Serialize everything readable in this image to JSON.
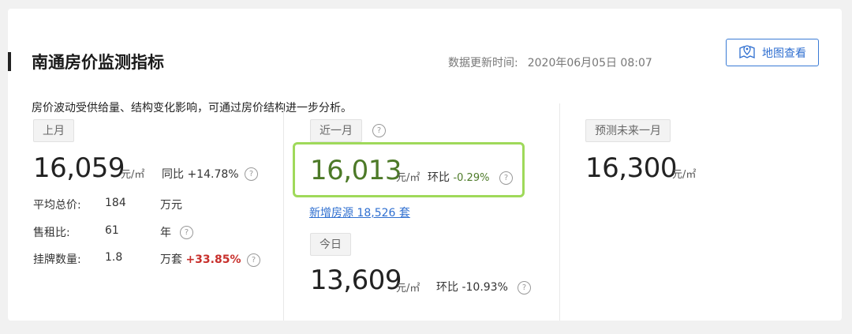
{
  "header": {
    "title": "南通房价监测指标",
    "update_label": "数据更新时间:",
    "update_time": "2020年06月05日 08:07",
    "map_button": "地图查看"
  },
  "description": "房价波动受供给量、结构变化影响，可通过房价结构进一步分析。",
  "last_month": {
    "tag": "上月",
    "price": "16,059",
    "unit": "元/㎡",
    "yoy_label": "同比",
    "yoy_value": "+14.78%",
    "rows": [
      {
        "label": "平均总价:",
        "value": "184",
        "unit": "万元"
      },
      {
        "label": "售租比:",
        "value": "61",
        "unit": "年"
      },
      {
        "label": "挂牌数量:",
        "value": "1.8",
        "unit": "万套",
        "change": "+33.85%"
      }
    ]
  },
  "recent_month": {
    "tag": "近一月",
    "price": "16,013",
    "unit": "元/㎡",
    "mom_label": "环比",
    "mom_value": "-0.29%",
    "new_listings": "新增房源 18,526 套"
  },
  "today": {
    "tag": "今日",
    "price": "13,609",
    "unit": "元/㎡",
    "mom_label": "环比",
    "mom_value": "-10.93%"
  },
  "forecast": {
    "tag": "预测未来一月",
    "price": "16,300",
    "unit": "元/㎡"
  },
  "help_icon": "?",
  "colors": {
    "accent": "#2f6fd0",
    "highlight_border": "#9fd95a",
    "increase": "#c8302c",
    "decrease_green": "#4d7a28"
  }
}
